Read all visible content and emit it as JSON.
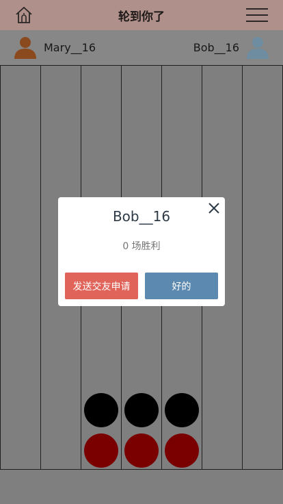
{
  "header": {
    "title": "轮到你了",
    "home_icon": "home-icon",
    "menu_icon": "hamburger-menu-icon"
  },
  "players": {
    "left": {
      "name": "Mary__16",
      "avatar_color": "#8b4a1d"
    },
    "right": {
      "name": "Bob__16",
      "avatar_color": "#6f8da0"
    }
  },
  "board": {
    "columns": 7,
    "pieces": [
      {
        "column": 3,
        "row_from_bottom": 1,
        "color": "red"
      },
      {
        "column": 4,
        "row_from_bottom": 1,
        "color": "red"
      },
      {
        "column": 5,
        "row_from_bottom": 1,
        "color": "red"
      },
      {
        "column": 3,
        "row_from_bottom": 2,
        "color": "black"
      },
      {
        "column": 4,
        "row_from_bottom": 2,
        "color": "black"
      },
      {
        "column": 5,
        "row_from_bottom": 2,
        "color": "black"
      }
    ]
  },
  "modal": {
    "title": "Bob__16",
    "subtitle": "0 场胜利",
    "friend_button": "发送交友申请",
    "ok_button": "好的",
    "colors": {
      "friend": "#e06459",
      "ok": "#5c89b0"
    }
  }
}
